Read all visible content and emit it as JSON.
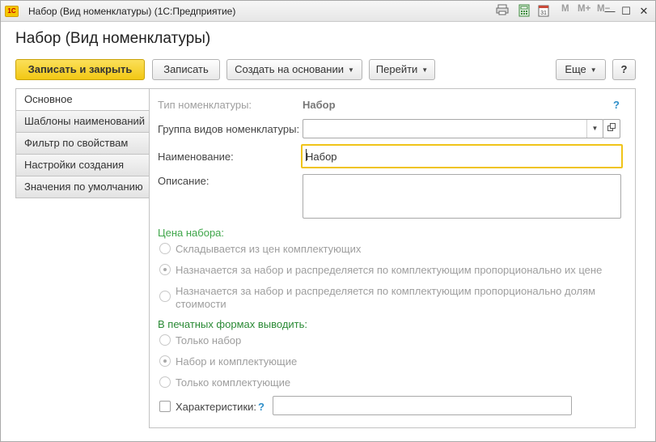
{
  "window": {
    "logo_text": "1С",
    "title": "Набор (Вид номенклатуры)  (1С:Предприятие)",
    "toolbar_icons": [
      "print-icon",
      "calculator-icon",
      "calendar-icon"
    ],
    "memory_labels": [
      "M",
      "M+",
      "M−"
    ],
    "controls": {
      "minimize": "—",
      "maximize": "☐",
      "close": "✕"
    }
  },
  "form": {
    "title": "Набор (Вид номенклатуры)"
  },
  "toolbar": {
    "save_close": "Записать и закрыть",
    "save": "Записать",
    "create_based": "Создать на основании",
    "goto": "Перейти",
    "more": "Еще",
    "help": "?"
  },
  "tabs": [
    {
      "label": "Основное",
      "active": true
    },
    {
      "label": "Шаблоны наименований",
      "active": false
    },
    {
      "label": "Фильтр по свойствам",
      "active": false
    },
    {
      "label": "Настройки создания",
      "active": false
    },
    {
      "label": "Значения по умолчанию",
      "active": false
    }
  ],
  "fields": {
    "type_label": "Тип номенклатуры:",
    "type_value": "Набор",
    "type_help": "?",
    "group_label": "Группа видов номенклатуры:",
    "group_value": "",
    "name_label": "Наименование:",
    "name_value": "Набор",
    "description_label": "Описание:",
    "description_value": ""
  },
  "price_group": {
    "title": "Цена набора:",
    "options": [
      {
        "label": "Складывается из цен комплектующих",
        "selected": false
      },
      {
        "label": "Назначается за набор и распределяется по комплектующим пропорционально их цене",
        "selected": true
      },
      {
        "label": "Назначается за набор и распределяется по комплектующим пропорционально долям",
        "label_line2": "стоимости",
        "selected": false
      }
    ]
  },
  "print_group": {
    "title": "В печатных формах выводить:",
    "options": [
      {
        "label": "Только набор",
        "selected": false
      },
      {
        "label": "Набор и комплектующие",
        "selected": true
      },
      {
        "label": "Только комплектующие",
        "selected": false
      }
    ]
  },
  "characteristics": {
    "label": "Характеристики:",
    "help": "?",
    "checked": false,
    "value": ""
  }
}
